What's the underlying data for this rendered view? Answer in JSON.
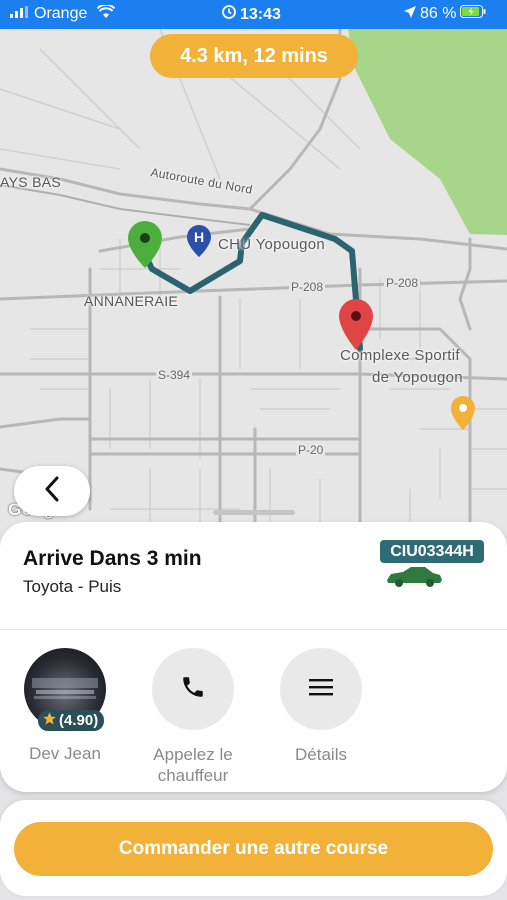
{
  "status_bar": {
    "carrier": "Orange",
    "time": "13:43",
    "battery": "86 %"
  },
  "map": {
    "eta": "4.3 km, 12 mins",
    "labels": {
      "ays_bas": "AYS BAS",
      "autoroute": "Autoroute du Nord",
      "chu": "CHU Yopougon",
      "annaneraie": "ANNANERAIE",
      "p208_a": "P-208",
      "p208_b": "P-208",
      "complexe_1": "Complexe Sportif",
      "complexe_2": "de Yopougon",
      "s394": "S-394",
      "p20": "P-20",
      "google": "Google",
      "hospital_letter": "H"
    },
    "colors": {
      "route": "#2b6470",
      "origin_pin": "#4caf3d",
      "dest_pin": "#e04545",
      "poi_pin": "#f2b23a",
      "park": "#a7d58a"
    }
  },
  "trip": {
    "title": "Arrive Dans 3 min",
    "vehicle": "Toyota - Puis",
    "plate": "CIU03344H"
  },
  "driver": {
    "name": "Dev Jean",
    "rating": "(4.90)"
  },
  "actions": {
    "call_label": "Appelez le chauffeur",
    "details_label": "Détails"
  },
  "order_button": "Commander une autre course",
  "icons": [
    "signal-icon",
    "wifi-icon",
    "alarm-icon",
    "location-arrow-icon",
    "battery-icon",
    "back-chevron-icon",
    "phone-icon",
    "menu-icon",
    "star-icon",
    "car-icon",
    "hospital-icon",
    "map-pin-icon"
  ]
}
